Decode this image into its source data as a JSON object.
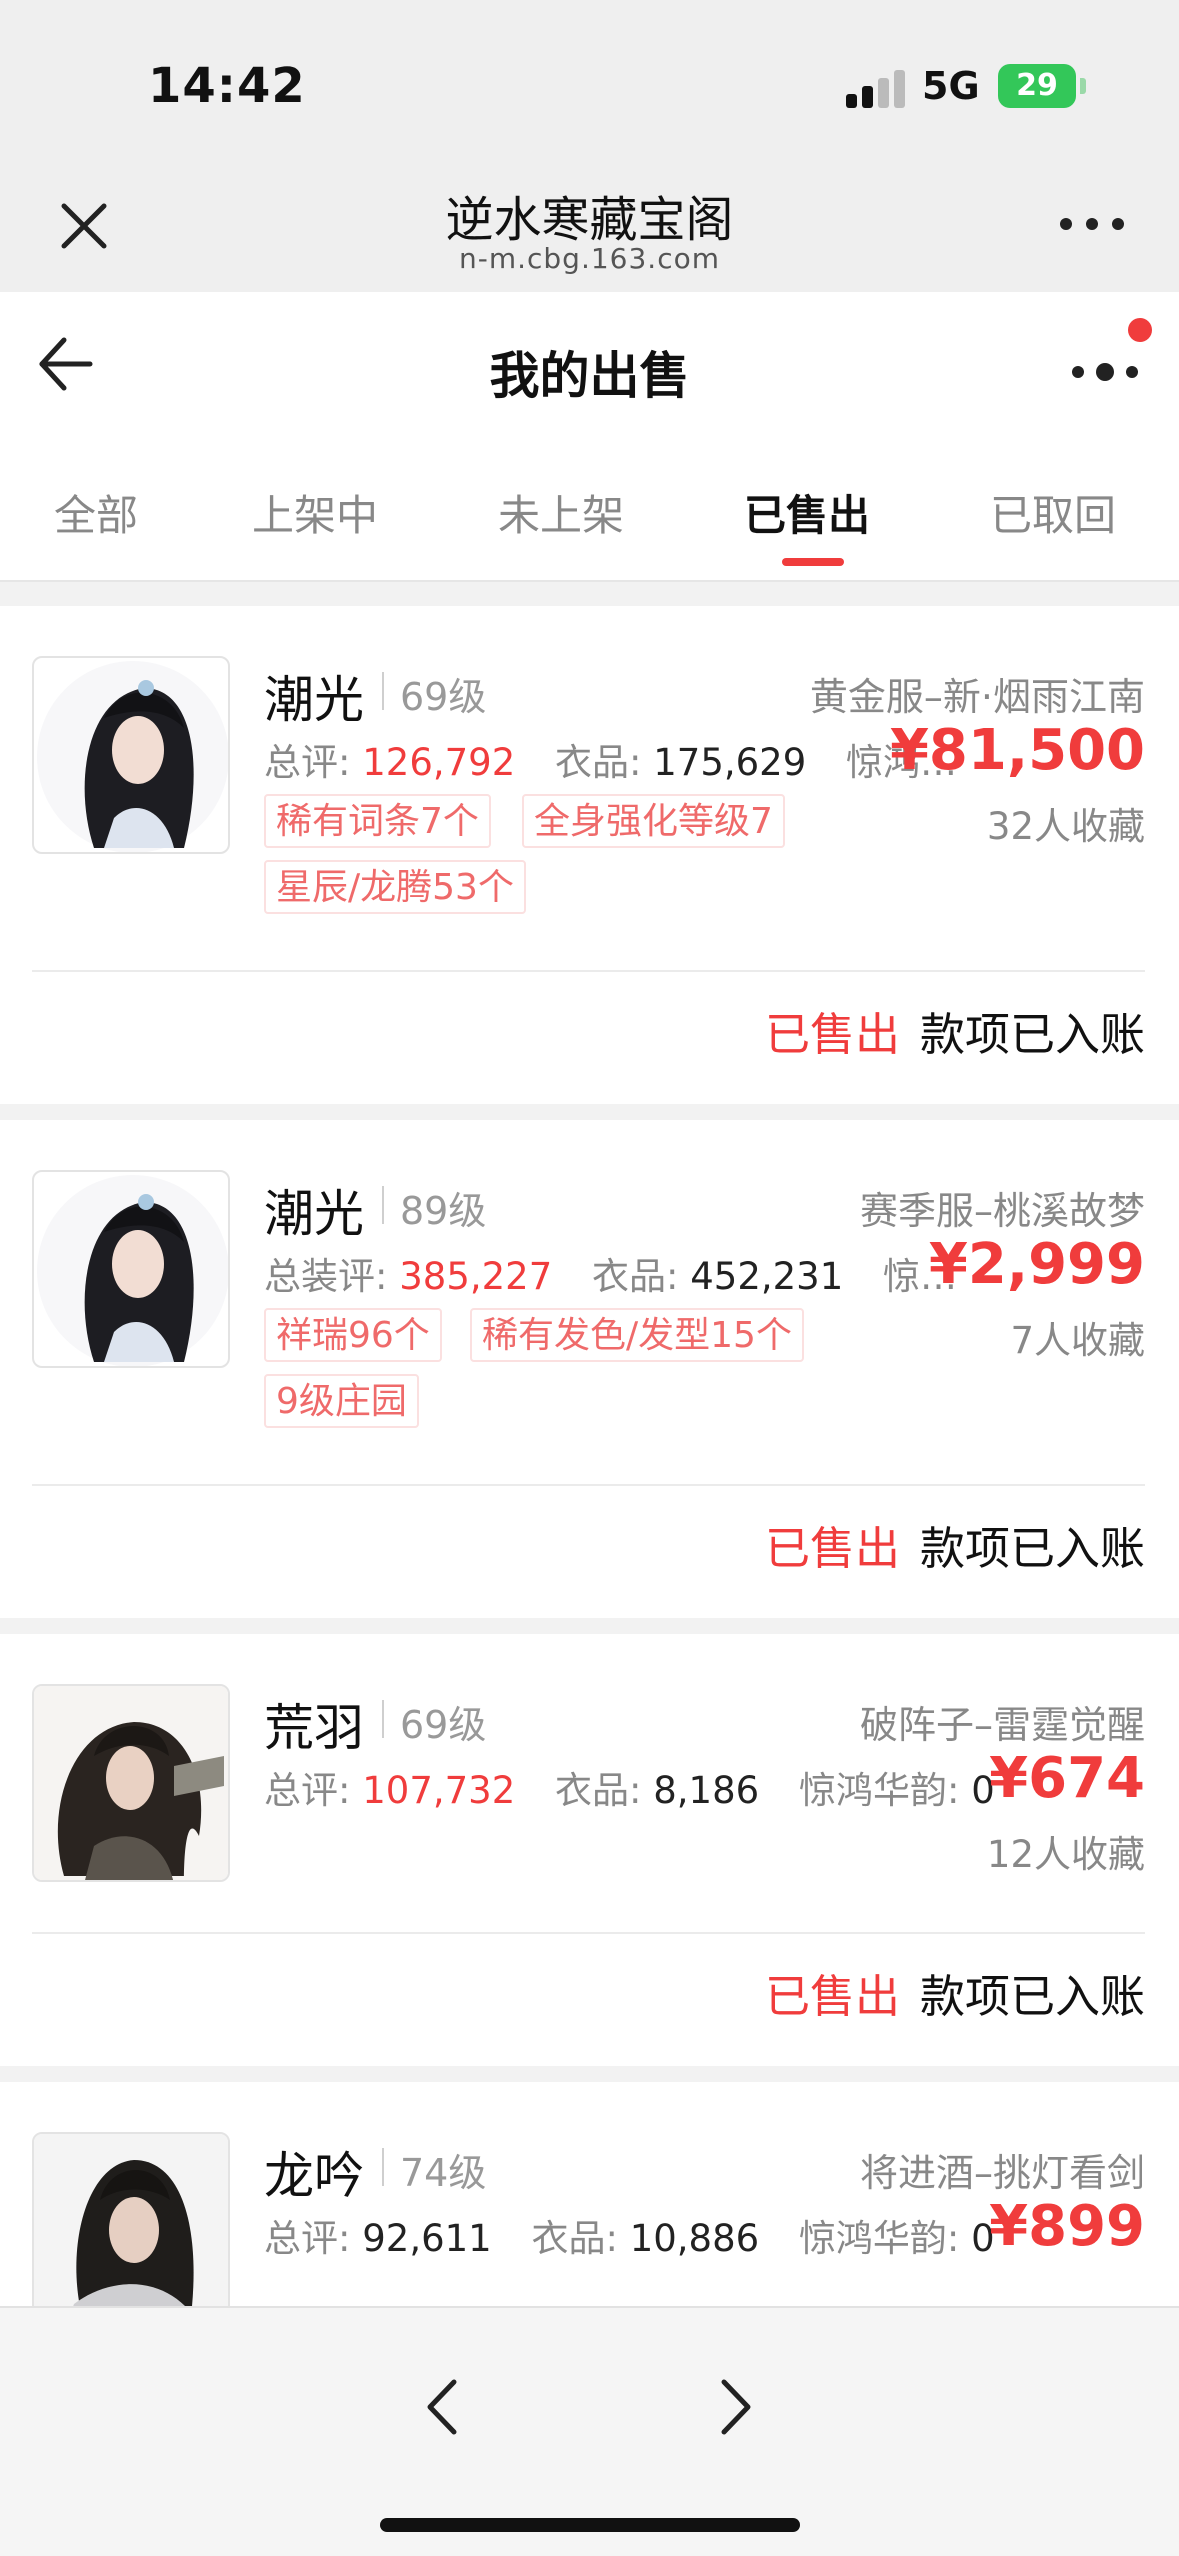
{
  "status_bar": {
    "time": "14:42",
    "network": "5G",
    "battery": "29"
  },
  "browser": {
    "title": "逆水寒藏宝阁",
    "url": "n-m.cbg.163.com"
  },
  "header": {
    "title": "我的出售"
  },
  "tabs": [
    {
      "label": "全部"
    },
    {
      "label": "上架中"
    },
    {
      "label": "未上架"
    },
    {
      "label": "已售出",
      "active": true
    },
    {
      "label": "已取回"
    }
  ],
  "listings": [
    {
      "name": "潮光",
      "level": "69级",
      "server": "黄金服–新·烟雨江南",
      "stat1_label": "总评:",
      "stat1_value": "126,792",
      "stat2_label": "衣品:",
      "stat2_value": "175,629",
      "stat3": "惊鸿…",
      "price": "¥81,500",
      "favorites": "32人收藏",
      "tags": [
        "稀有词条7个",
        "全身强化等级7",
        "星辰/龙腾53个"
      ],
      "status": "已售出",
      "payment": "款项已入账"
    },
    {
      "name": "潮光",
      "level": "89级",
      "server": "赛季服–桃溪故梦",
      "stat1_label": "总装评:",
      "stat1_value": "385,227",
      "stat2_label": "衣品:",
      "stat2_value": "452,231",
      "stat3": "惊…",
      "price": "¥2,999",
      "favorites": "7人收藏",
      "tags": [
        "祥瑞96个",
        "稀有发色/发型15个",
        "9级庄园"
      ],
      "status": "已售出",
      "payment": "款项已入账"
    },
    {
      "name": "荒羽",
      "level": "69级",
      "server": "破阵子–雷霆觉醒",
      "stat1_label": "总评:",
      "stat1_value": "107,732",
      "stat2_label": "衣品:",
      "stat2_value": "8,186",
      "stat3_label": "惊鸿华韵:",
      "stat3_value": "0",
      "price": "¥674",
      "favorites": "12人收藏",
      "tags": [],
      "status": "已售出",
      "payment": "款项已入账"
    },
    {
      "name": "龙吟",
      "level": "74级",
      "server": "将进酒–挑灯看剑",
      "stat1_label": "总评:",
      "stat1_value": "92,611",
      "stat2_label": "衣品:",
      "stat2_value": "10,886",
      "stat3_label": "惊鸿华韵:",
      "stat3_value": "0",
      "price": "¥899"
    }
  ],
  "colors": {
    "accent": "#f03c3c",
    "tag_text": "#ef6a6a",
    "tag_border": "#fbe0e0",
    "battery": "#33c759"
  },
  "icons": {
    "close": "close-icon",
    "more": "more-icon",
    "back": "back-arrow-icon",
    "prev": "chevron-left-icon",
    "next": "chevron-right-icon"
  }
}
